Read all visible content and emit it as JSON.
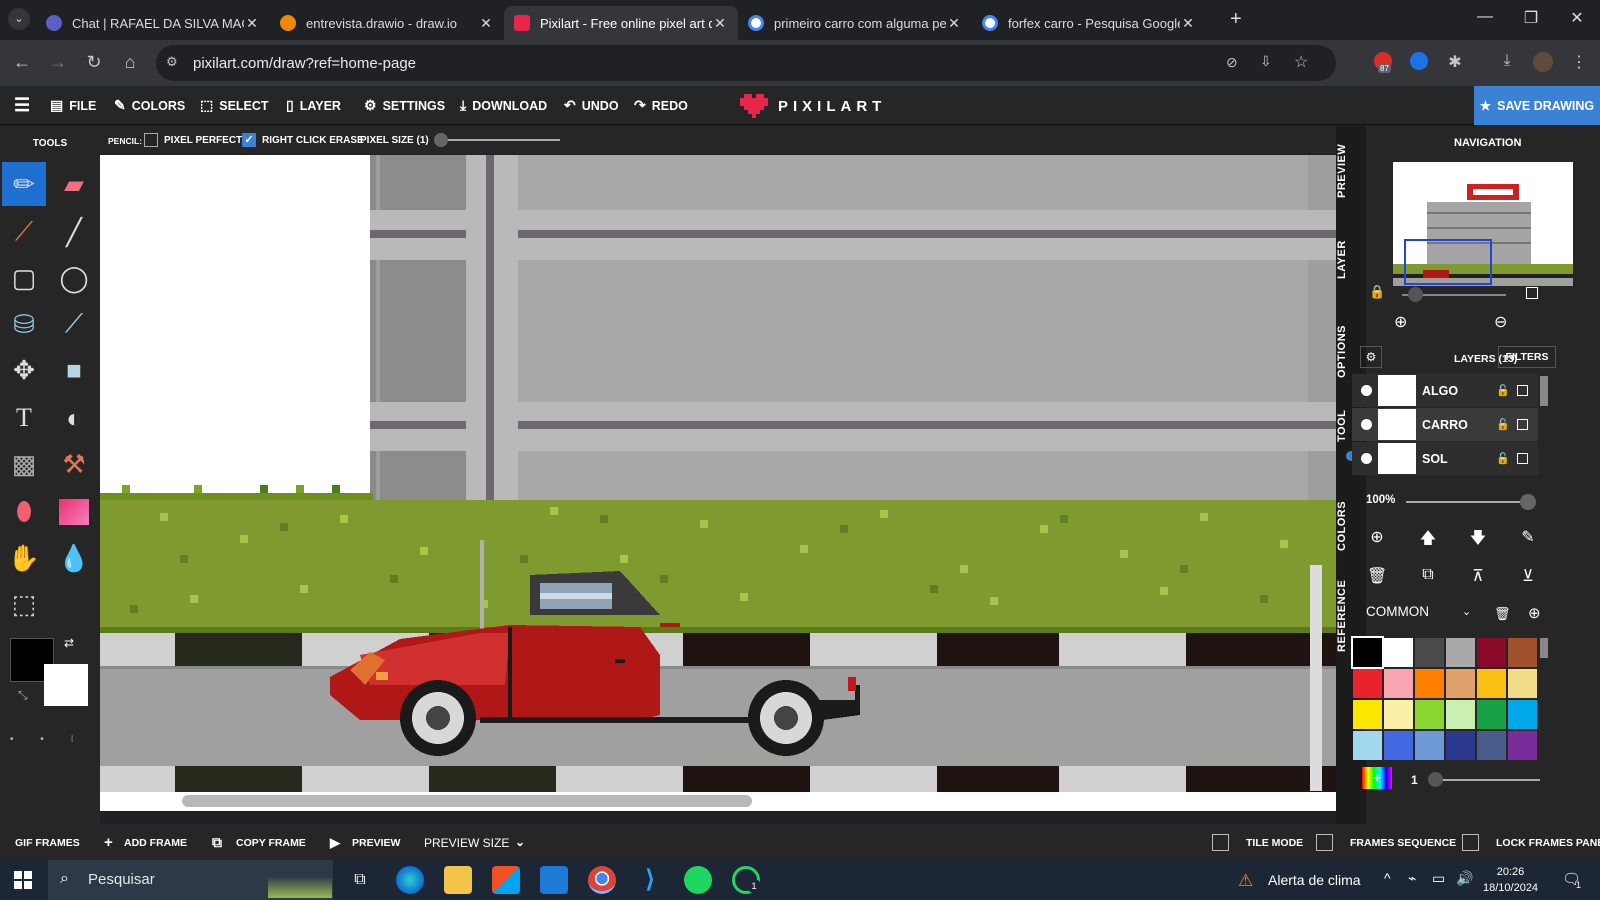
{
  "browser": {
    "tabs": [
      {
        "title": "Chat | RAFAEL DA SILVA MACHADO",
        "color": "#5b5fc7"
      },
      {
        "title": "entrevista.drawio - draw.io",
        "color": "#f08705"
      },
      {
        "title": "Pixilart - Free online pixel art drawing",
        "color": "#e8264a"
      },
      {
        "title": "primeiro carro com alguma pelicula",
        "color": "#4285f4"
      },
      {
        "title": "forfex carro - Pesquisa Google",
        "color": "#4285f4"
      }
    ],
    "url": "pixilart.com/draw?ref=home-page",
    "extension_badge": "87"
  },
  "menu": {
    "file": "FILE",
    "colors": "COLORS",
    "select": "SELECT",
    "layer": "LAYER",
    "settings": "SETTINGS",
    "download": "DOWNLOAD",
    "undo": "UNDO",
    "redo": "REDO",
    "logo": "PIXILART",
    "save": "SAVE DRAWING"
  },
  "tools": {
    "title": "TOOLS",
    "primary_color": "#000000",
    "secondary_color": "#ffffff"
  },
  "options": {
    "tool": "PENCIL:",
    "pixel_perfect": "PIXEL PERFECT",
    "right_click_erase": "RIGHT CLICK ERASE",
    "pixel_size": "PIXEL SIZE (1)",
    "pixel_perfect_checked": false,
    "right_click_erase_checked": true
  },
  "side_tabs": [
    "PREVIEW",
    "LAYER",
    "OPTIONS",
    "TOOL",
    "COLORS",
    "REFERENCE"
  ],
  "navigation": {
    "title": "NAVIGATION"
  },
  "layers": {
    "title": "LAYERS (13)",
    "filters": "FILTERS",
    "items": [
      {
        "name": "ALGO"
      },
      {
        "name": "CARRO"
      },
      {
        "name": "SOL"
      }
    ],
    "opacity": "100%"
  },
  "palette": {
    "name": "COMMON",
    "brush_size": "1",
    "colors": [
      "#000000",
      "#ffffff",
      "#4a4a4a",
      "#a9a9a9",
      "#8b0a2a",
      "#a0522d",
      "#e8232b",
      "#f7a5b0",
      "#ff7f00",
      "#dfa06a",
      "#fbbf13",
      "#f3dd8a",
      "#fbe600",
      "#fbf0a8",
      "#8ad631",
      "#c8f0b0",
      "#18a045",
      "#00a8e8",
      "#a0d8ef",
      "#4169e1",
      "#6f98d8",
      "#2b3a8f",
      "#4a5d8a",
      "#7a2b9c"
    ]
  },
  "frames": {
    "gif_frames": "GIF FRAMES",
    "add_frame": "ADD FRAME",
    "copy_frame": "COPY FRAME",
    "preview": "PREVIEW",
    "preview_size": "PREVIEW SIZE",
    "tile_mode": "TILE MODE",
    "frames_sequence": "FRAMES SEQUENCE",
    "lock_frames_panel": "LOCK FRAMES PANEL"
  },
  "taskbar": {
    "search_placeholder": "Pesquisar",
    "weather": "Alerta de clima",
    "time": "20:26",
    "date": "18/10/2024",
    "notification_count": "1",
    "whatsapp_badge": "1"
  }
}
